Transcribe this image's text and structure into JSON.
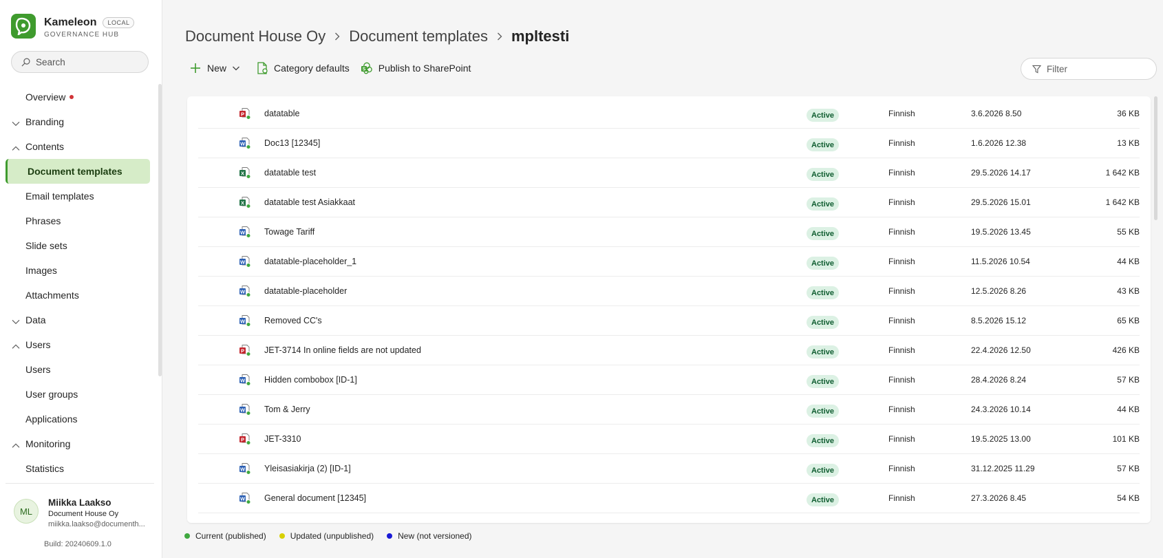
{
  "colors": {
    "accent": "#3f9b2e",
    "active_bg": "#d6ecc8",
    "status_bg": "#dcf1e4",
    "status_text": "#0e5c2f",
    "dot_current": "#3fa83f",
    "dot_updated": "#d8d000",
    "dot_new": "#1a1ad6",
    "word": "#2b5fb4",
    "excel": "#217346",
    "pdf": "#c4262e"
  },
  "brand": {
    "name": "Kameleon",
    "env": "LOCAL",
    "subtitle": "GOVERNANCE HUB",
    "logo_icon": "kameleon-logo-icon"
  },
  "search": {
    "placeholder": "Search",
    "icon": "search-icon"
  },
  "nav": [
    {
      "label": "Overview",
      "chevron": "none",
      "dot": true,
      "active": false
    },
    {
      "label": "Branding",
      "chevron": "down",
      "active": false
    },
    {
      "label": "Contents",
      "chevron": "up",
      "active": false
    },
    {
      "label": "Document templates",
      "chevron": "none",
      "active": true
    },
    {
      "label": "Email templates",
      "chevron": "none",
      "active": false
    },
    {
      "label": "Phrases",
      "chevron": "none",
      "active": false
    },
    {
      "label": "Slide sets",
      "chevron": "none",
      "active": false
    },
    {
      "label": "Images",
      "chevron": "none",
      "active": false
    },
    {
      "label": "Attachments",
      "chevron": "none",
      "active": false
    },
    {
      "label": "Data",
      "chevron": "down",
      "active": false
    },
    {
      "label": "Users",
      "chevron": "up",
      "active": false
    },
    {
      "label": "Users",
      "chevron": "none",
      "active": false
    },
    {
      "label": "User groups",
      "chevron": "none",
      "active": false
    },
    {
      "label": "Applications",
      "chevron": "none",
      "active": false
    },
    {
      "label": "Monitoring",
      "chevron": "up",
      "active": false
    },
    {
      "label": "Statistics",
      "chevron": "none",
      "active": false
    }
  ],
  "user": {
    "initials": "ML",
    "name": "Miikka Laakso",
    "org": "Document House Oy",
    "email": "miikka.laakso@documenth..."
  },
  "build": "Build: 20240609.1.0",
  "breadcrumb": [
    "Document House Oy",
    "Document templates",
    "mpltesti"
  ],
  "toolbar": {
    "new_label": "New",
    "category_defaults_label": "Category defaults",
    "publish_label": "Publish to SharePoint"
  },
  "filter": {
    "placeholder": "Filter"
  },
  "rows": [
    {
      "type": "pdf",
      "name": "datatable",
      "status": "Active",
      "language": "Finnish",
      "modified": "3.6.2026 8.50",
      "size": "36 KB"
    },
    {
      "type": "word",
      "name": "Doc13 [12345]",
      "status": "Active",
      "language": "Finnish",
      "modified": "1.6.2026 12.38",
      "size": "13 KB"
    },
    {
      "type": "excel",
      "name": "datatable test",
      "status": "Active",
      "language": "Finnish",
      "modified": "29.5.2026 14.17",
      "size": "1 642 KB"
    },
    {
      "type": "excel",
      "name": "datatable test Asiakkaat",
      "status": "Active",
      "language": "Finnish",
      "modified": "29.5.2026 15.01",
      "size": "1 642 KB"
    },
    {
      "type": "word",
      "name": "Towage Tariff",
      "status": "Active",
      "language": "Finnish",
      "modified": "19.5.2026 13.45",
      "size": "55 KB"
    },
    {
      "type": "word",
      "name": "datatable-placeholder_1",
      "status": "Active",
      "language": "Finnish",
      "modified": "11.5.2026 10.54",
      "size": "44 KB"
    },
    {
      "type": "word",
      "name": "datatable-placeholder",
      "status": "Active",
      "language": "Finnish",
      "modified": "12.5.2026 8.26",
      "size": "43 KB"
    },
    {
      "type": "word",
      "name": "Removed CC's",
      "status": "Active",
      "language": "Finnish",
      "modified": "8.5.2026 15.12",
      "size": "65 KB"
    },
    {
      "type": "pdf",
      "name": "JET-3714 In online fields are not updated",
      "status": "Active",
      "language": "Finnish",
      "modified": "22.4.2026 12.50",
      "size": "426 KB"
    },
    {
      "type": "word",
      "name": "Hidden combobox [ID-1]",
      "status": "Active",
      "language": "Finnish",
      "modified": "28.4.2026 8.24",
      "size": "57 KB"
    },
    {
      "type": "word",
      "name": "Tom & Jerry",
      "status": "Active",
      "language": "Finnish",
      "modified": "24.3.2026 10.14",
      "size": "44 KB"
    },
    {
      "type": "pdf",
      "name": "JET-3310",
      "status": "Active",
      "language": "Finnish",
      "modified": "19.5.2025 13.00",
      "size": "101 KB"
    },
    {
      "type": "word",
      "name": "Yleisasiakirja (2) [ID-1]",
      "status": "Active",
      "language": "Finnish",
      "modified": "31.12.2025 11.29",
      "size": "57 KB"
    },
    {
      "type": "word",
      "name": "General document [12345]",
      "status": "Active",
      "language": "Finnish",
      "modified": "27.3.2026 8.45",
      "size": "54 KB"
    }
  ],
  "legend": [
    {
      "label": "Current (published)",
      "color": "#3fa83f"
    },
    {
      "label": "Updated (unpublished)",
      "color": "#d8d000"
    },
    {
      "label": "New (not versioned)",
      "color": "#1a1ad6"
    }
  ]
}
